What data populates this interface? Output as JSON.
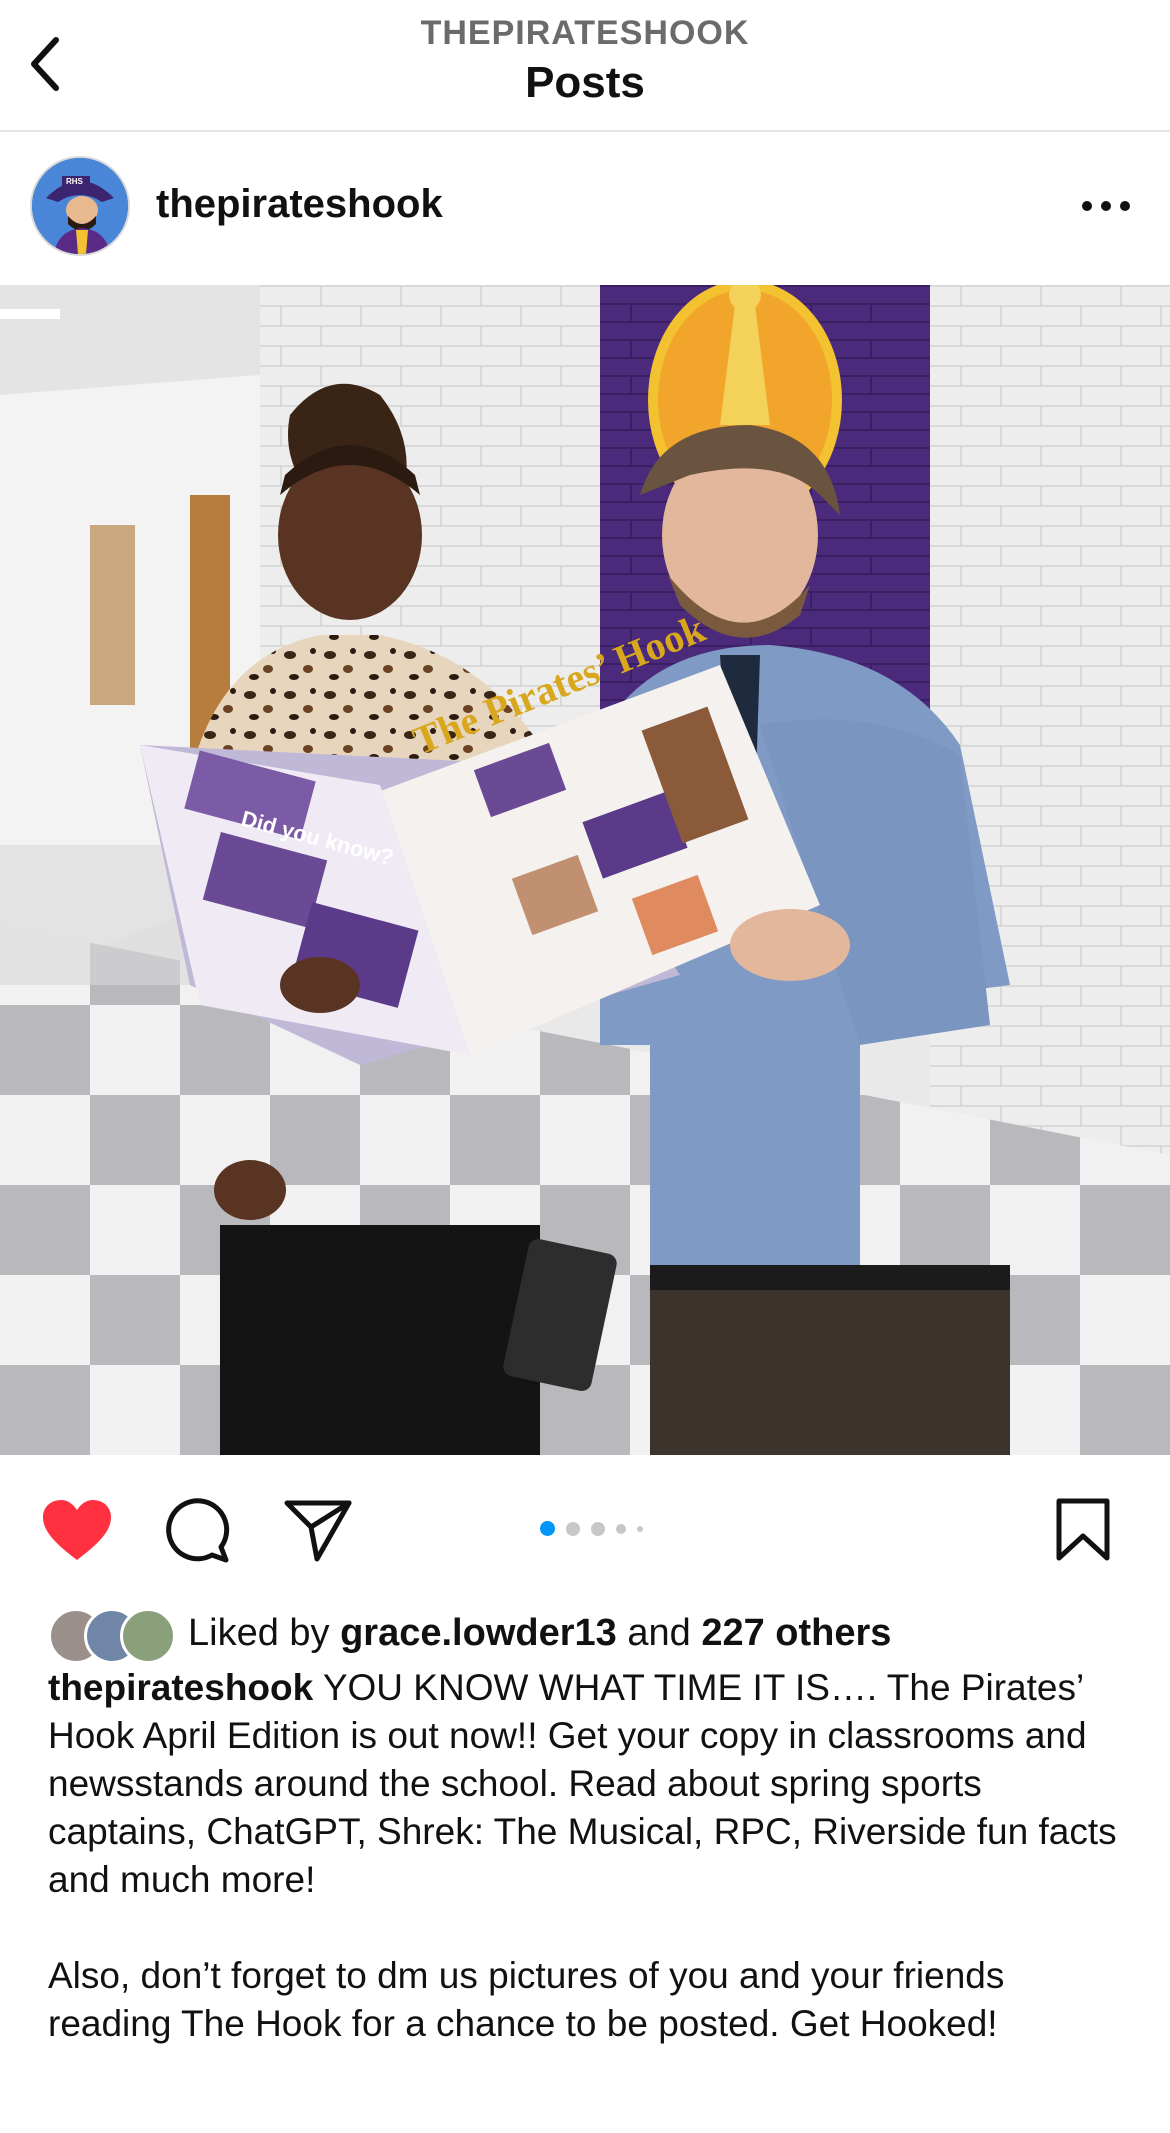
{
  "header": {
    "account": "THEPIRATESHOOK",
    "title": "Posts"
  },
  "post": {
    "username": "thepirateshook",
    "liked_by_prefix": "Liked by ",
    "liked_by_user": "grace.lowder13",
    "liked_by_and": " and ",
    "liked_by_others": "227 others",
    "caption_username": "thepirateshook",
    "caption_p1": " YOU KNOW WHAT TIME IT IS…. The Pirates’ Hook April Edition is out now!! Get your copy in classrooms and newsstands around the school. Read about spring sports captains, ChatGPT, Shrek: The Musical, RPC, Riverside fun facts and much more!",
    "caption_p2": "Also, don’t forget to dm us pictures of you and your friends reading The Hook for a chance to be posted. Get Hooked!",
    "liked": true,
    "carousel_count": 5,
    "carousel_active": 1
  },
  "photo": {
    "newspaper_title": "The Pirates’ Hook",
    "sidebar_heading": "Did you know?"
  },
  "icons": {
    "back": "chevron-left-icon",
    "more": "more-horizontal-icon",
    "like": "heart-icon",
    "comment": "comment-icon",
    "share": "send-icon",
    "save": "bookmark-icon"
  },
  "colors": {
    "like_red": "#ff3040",
    "carousel_active": "#0095f6",
    "school_purple": "#5b2a86",
    "school_gold": "#f2a52b"
  }
}
